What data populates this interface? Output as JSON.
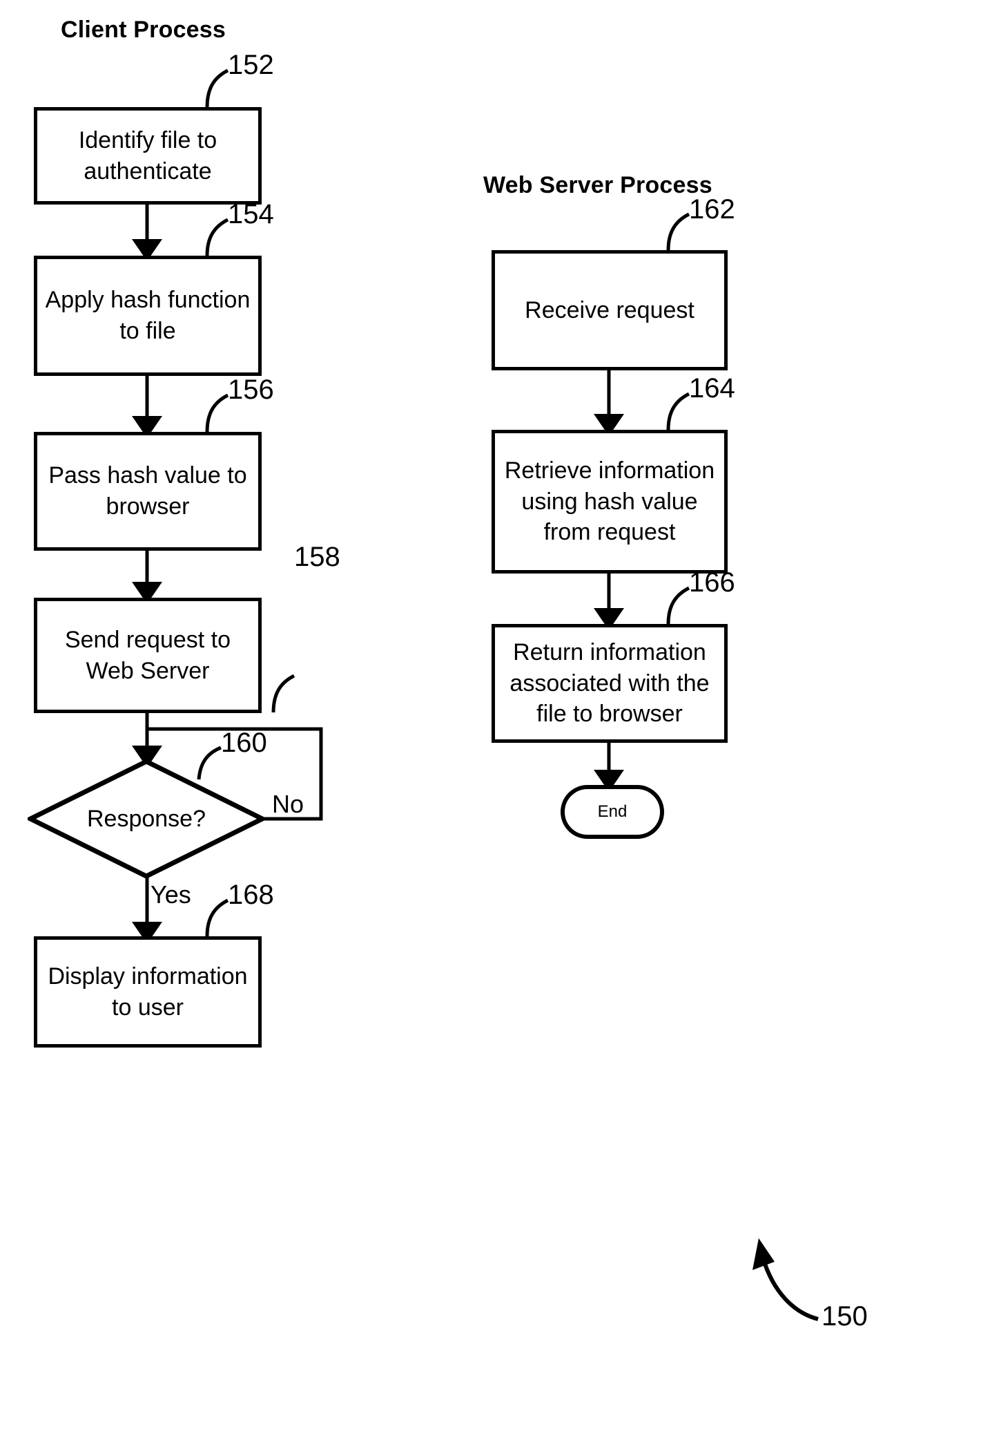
{
  "figure": {
    "reference_numeral": "150",
    "columns": [
      {
        "id": "client",
        "title": "Client Process"
      },
      {
        "id": "server",
        "title": "Web Server Process"
      }
    ]
  },
  "client_process": {
    "title": "Client Process",
    "steps": [
      {
        "ref": "152",
        "label": "Identify file to authenticate",
        "shape": "process"
      },
      {
        "ref": "154",
        "label": "Apply hash function to file",
        "shape": "process"
      },
      {
        "ref": "156",
        "label": "Pass hash value to browser",
        "shape": "process"
      },
      {
        "ref": "158",
        "label": "Send request to Web Server",
        "shape": "process"
      },
      {
        "ref": "160",
        "label": "Response?",
        "shape": "decision"
      },
      {
        "ref": "168",
        "label": "Display information to user",
        "shape": "process"
      }
    ],
    "decision_branches": {
      "no_label": "No",
      "yes_label": "Yes"
    }
  },
  "server_process": {
    "title": "Web Server Process",
    "steps": [
      {
        "ref": "162",
        "label": "Receive request",
        "shape": "process"
      },
      {
        "ref": "164",
        "label": "Retrieve information using hash value from request",
        "shape": "process"
      },
      {
        "ref": "166",
        "label": "Return information associated with the file to browser",
        "shape": "process"
      }
    ],
    "terminator": {
      "label": "End",
      "shape": "terminator"
    }
  },
  "colors": {
    "line": "#000000",
    "background": "#ffffff",
    "text": "#000000"
  }
}
